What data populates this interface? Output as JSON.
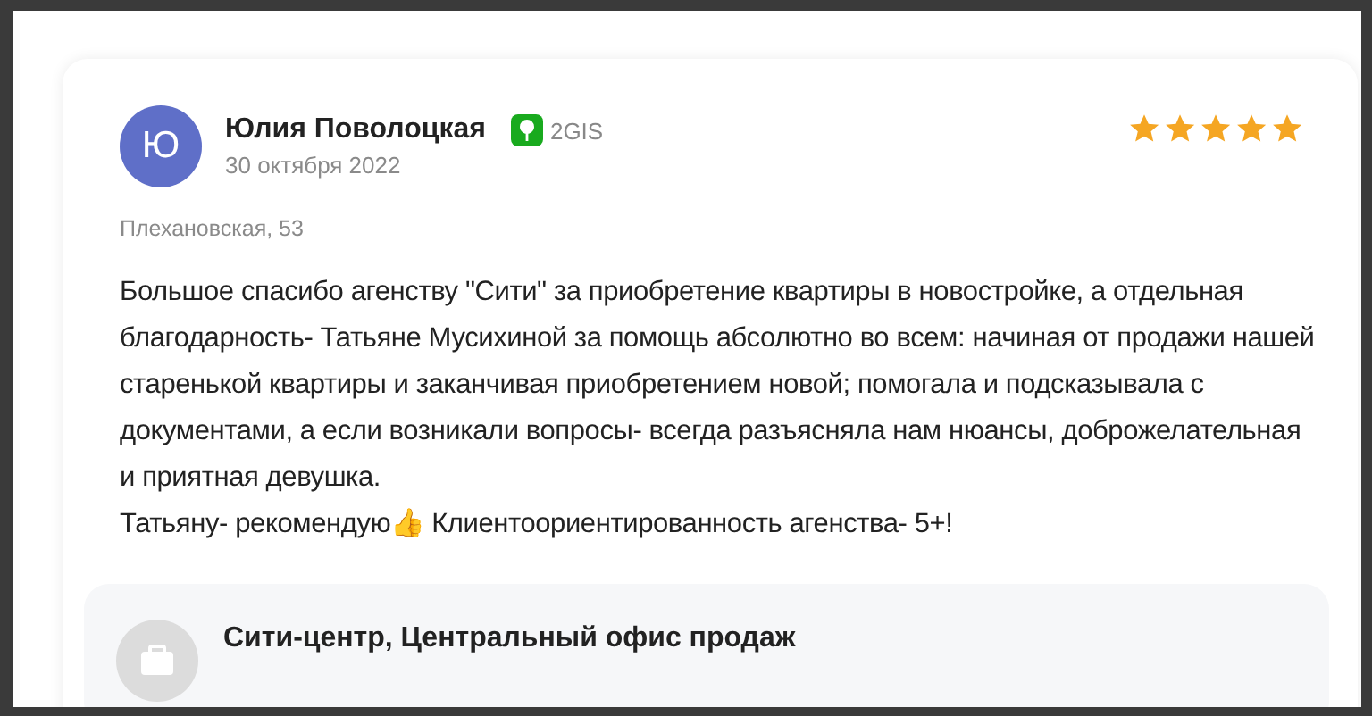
{
  "review": {
    "author": "Юлия Поволоцкая",
    "avatar_letter": "Ю",
    "source": "2GIS",
    "date": "30 октября 2022",
    "stars": 5,
    "address": "Плехановская, 53",
    "paragraphs": [
      "Большое спасибо агенству \"Сити\" за приобретение квартиры в новостройке, а отдельная благодарность- Татьяне Мусихиной за помощь абсолютно во всем: начиная от продажи нашей старенькой квартиры и заканчивая приобретением новой; помогала и подсказывала с документами, а если возникали вопросы- всегда разъясняла нам нюансы, доброжелательная и приятная девушка.",
      "Татьяну- рекомендую👍 Клиентоориентированность агенства- 5+!"
    ]
  },
  "office": {
    "name": "Сити-центр, Центральный офис продаж"
  }
}
